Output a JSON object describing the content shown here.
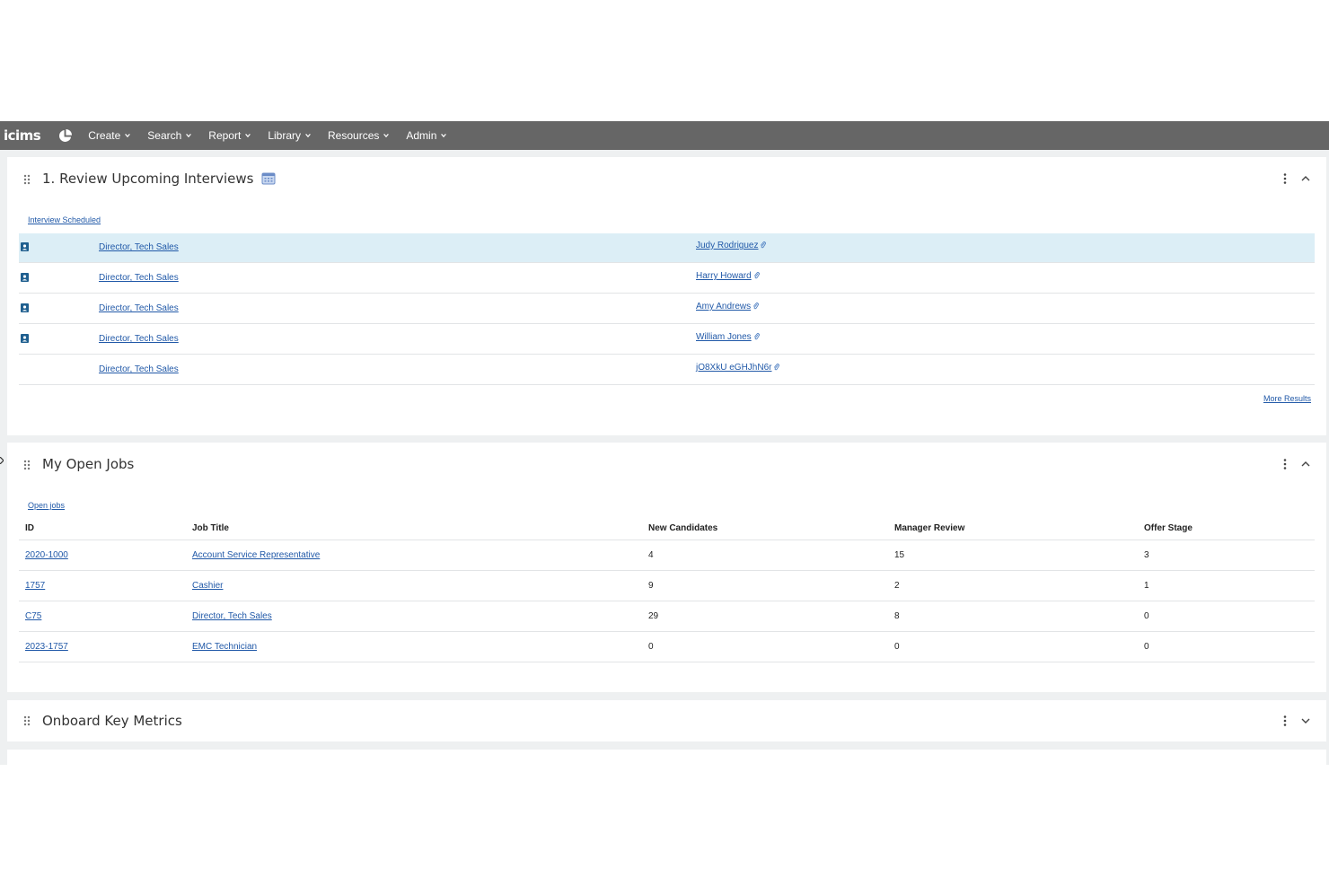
{
  "nav": {
    "logo": "icims",
    "items": [
      {
        "label": "Create"
      },
      {
        "label": "Search"
      },
      {
        "label": "Report"
      },
      {
        "label": "Library"
      },
      {
        "label": "Resources"
      },
      {
        "label": "Admin"
      }
    ]
  },
  "interviews": {
    "title": "1. Review Upcoming Interviews",
    "sublink": "Interview Scheduled",
    "rows": [
      {
        "job": "Director, Tech Sales",
        "candidate": "Judy Rodriguez"
      },
      {
        "job": "Director, Tech Sales",
        "candidate": "Harry Howard"
      },
      {
        "job": "Director, Tech Sales",
        "candidate": "Amy Andrews"
      },
      {
        "job": "Director, Tech Sales",
        "candidate": "William Jones"
      },
      {
        "job": "Director, Tech Sales",
        "candidate": "jO8XkU eGHJhN6r"
      }
    ],
    "more": "More Results"
  },
  "jobs": {
    "title": "My Open Jobs",
    "sublink": "Open jobs",
    "headers": {
      "id": "ID",
      "title": "Job Title",
      "new": "New Candidates",
      "review": "Manager Review",
      "offer": "Offer Stage"
    },
    "rows": [
      {
        "id": "2020-1000",
        "title": "Account Service Representative",
        "new": "4",
        "review": "15",
        "offer": "3"
      },
      {
        "id": "1757",
        "title": "Cashier",
        "new": "9",
        "review": "2",
        "offer": "1"
      },
      {
        "id": "C75",
        "title": "Director, Tech Sales",
        "new": "29",
        "review": "8",
        "offer": "0"
      },
      {
        "id": "2023-1757",
        "title": "EMC Technician",
        "new": "0",
        "review": "0",
        "offer": "0"
      }
    ]
  },
  "metrics": {
    "title": "Onboard Key Metrics"
  },
  "colors": {
    "topbar": "#666666",
    "link": "#2159a8",
    "highlight": "#dceef6"
  }
}
